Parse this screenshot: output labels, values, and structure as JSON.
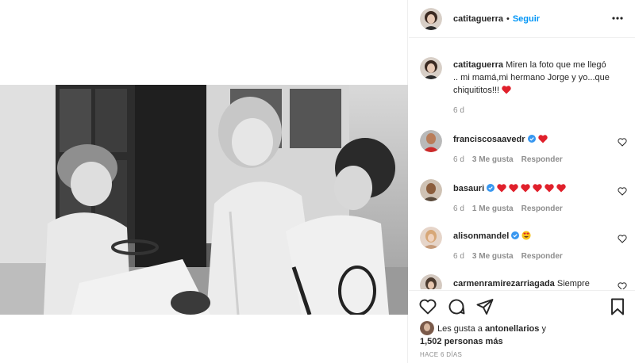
{
  "post": {
    "username": "catitaguerra",
    "separator": "•",
    "follow_label": "Seguir",
    "caption": {
      "username": "catitaguerra",
      "text": "Miren la foto que me llegó .. mi mamá,mi hermano Jorge y yo...que chiquititos!!!",
      "time": "6 d"
    },
    "comments": [
      {
        "username": "franciscosaavedr",
        "time": "6 d",
        "likes": "3 Me gusta",
        "reply": "Responder"
      },
      {
        "username": "basauri",
        "time": "6 d",
        "likes": "1 Me gusta",
        "reply": "Responder"
      },
      {
        "username": "alisonmandel",
        "time": "6 d",
        "likes": "3 Me gusta",
        "reply": "Responder"
      },
      {
        "username": "carmenramirezarriagada",
        "text": "Siempre"
      }
    ],
    "likes": {
      "prefix": "Les gusta a",
      "user": "antonellarios",
      "conj": "y",
      "count": "1,502 personas más"
    },
    "posted": "HACE 6 DÍAS"
  },
  "icons": {
    "more": "more-options-icon",
    "like": "heart-icon",
    "comment": "comment-icon",
    "share": "share-icon",
    "save": "bookmark-icon"
  },
  "colors": {
    "accent": "#0095f6",
    "heart": "#ed4956",
    "verified": "#3897f0",
    "muted": "#8e8e8e"
  }
}
